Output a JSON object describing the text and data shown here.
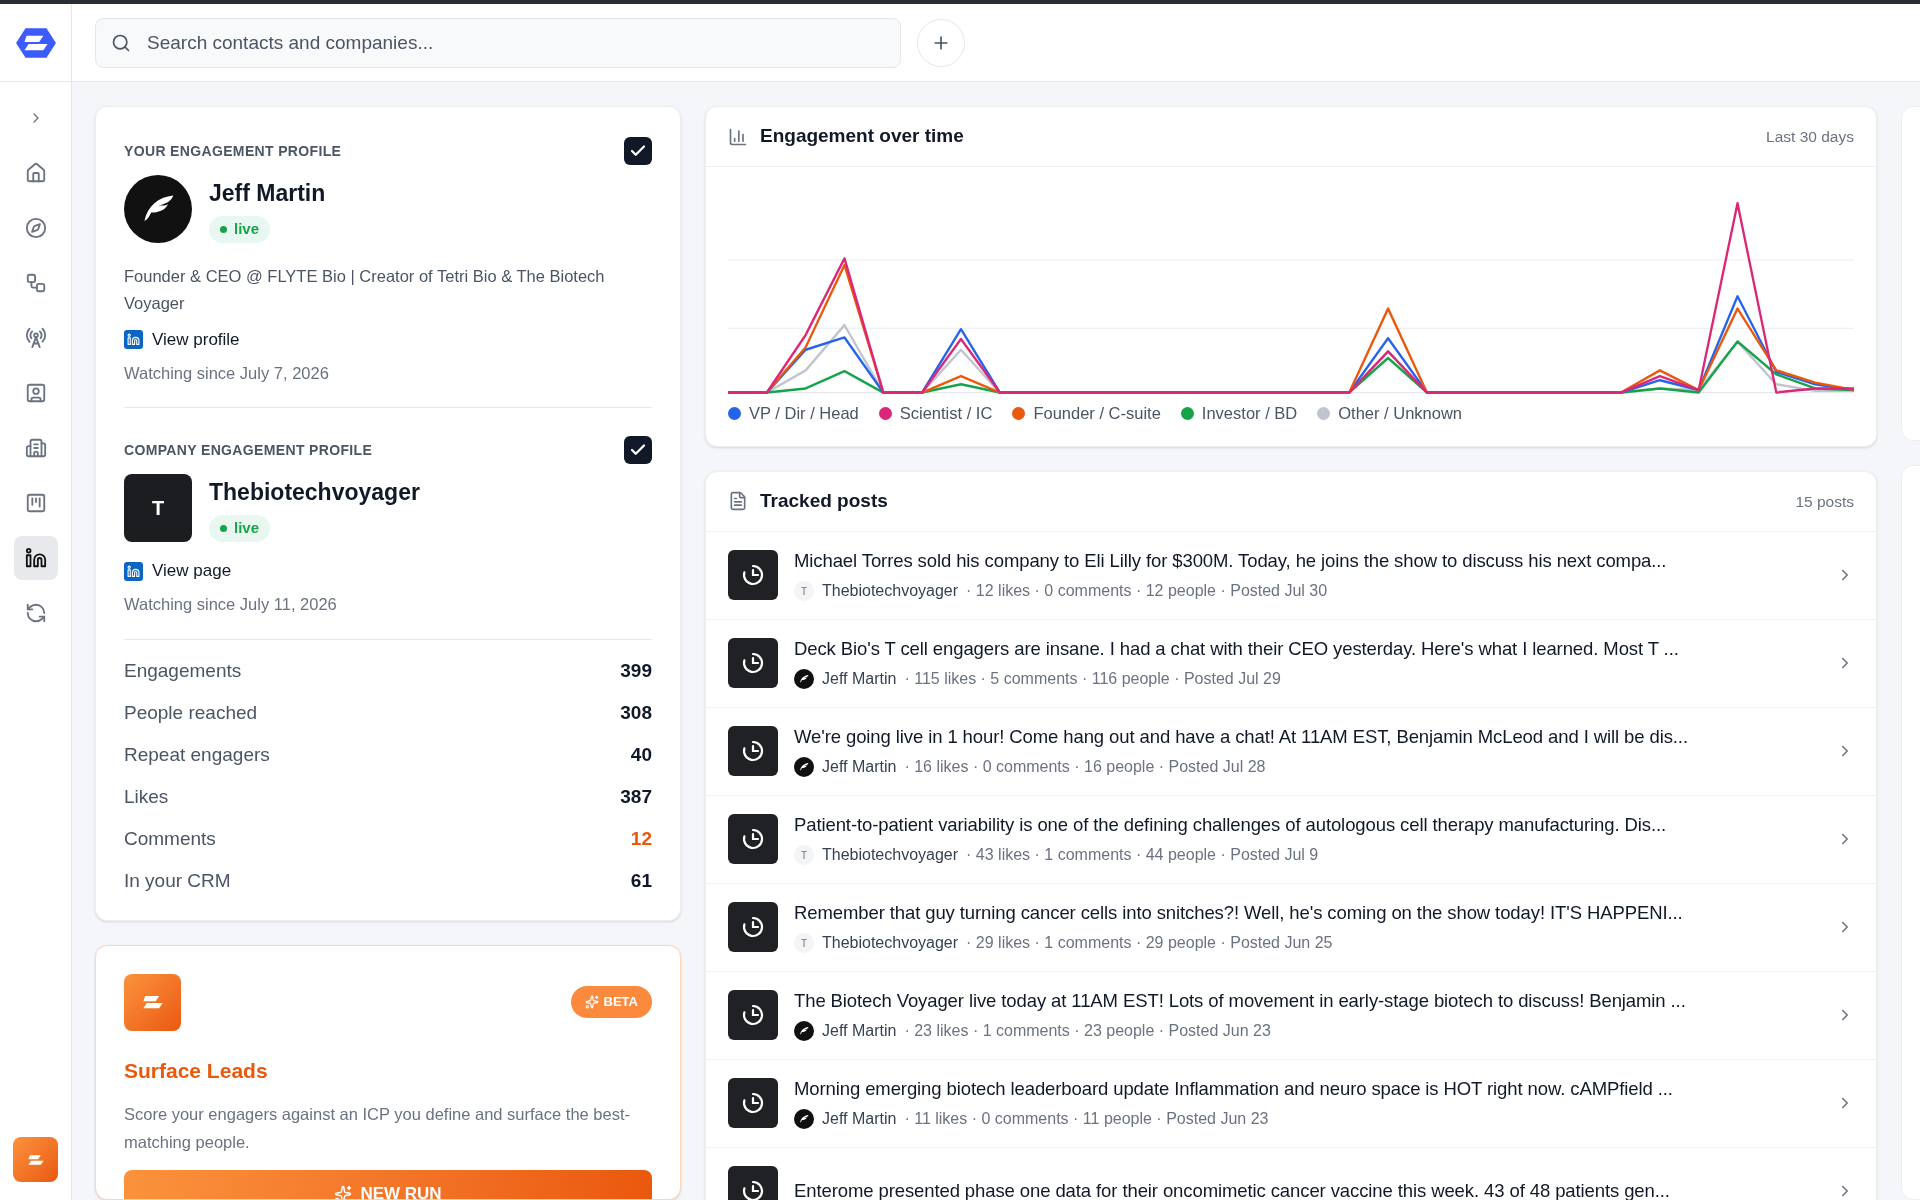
{
  "sidebar": {
    "items": [
      {
        "kind": "expand",
        "selected": false
      },
      {
        "kind": "home",
        "selected": false
      },
      {
        "kind": "explore",
        "selected": false
      },
      {
        "kind": "workflow",
        "selected": false
      },
      {
        "kind": "signals",
        "selected": false
      },
      {
        "kind": "contacts",
        "selected": false
      },
      {
        "kind": "companies",
        "selected": false
      },
      {
        "kind": "board",
        "selected": false
      },
      {
        "kind": "linkedin",
        "selected": true
      },
      {
        "kind": "sync",
        "selected": false
      }
    ]
  },
  "search": {
    "placeholder": "Search contacts and companies..."
  },
  "profiles": [
    {
      "kind": "person",
      "heading": "YOUR ENGAGEMENT PROFILE",
      "checked": true,
      "name": "Jeff Martin",
      "status": "live",
      "bio": "Founder & CEO @ FLYTE Bio | Creator of Tetri Bio & The Biotech Voyager",
      "link": "View profile",
      "since": "Watching since July 7, 2026"
    },
    {
      "kind": "company",
      "heading": "COMPANY ENGAGEMENT PROFILE",
      "checked": true,
      "name": "Thebiotechvoyager",
      "initial": "T",
      "status": "live",
      "link": "View page",
      "since": "Watching since July 11, 2026"
    }
  ],
  "stats": [
    {
      "label": "Engagements",
      "value": "399",
      "highlighted": false
    },
    {
      "label": "People reached",
      "value": "308",
      "highlighted": false
    },
    {
      "label": "Repeat engagers",
      "value": "40",
      "highlighted": false
    },
    {
      "label": "Likes",
      "value": "387",
      "highlighted": false
    },
    {
      "label": "Comments",
      "value": "12",
      "highlighted": true
    },
    {
      "label": "In your CRM",
      "value": "61",
      "highlighted": false
    }
  ],
  "surface_leads": {
    "badge": "BETA",
    "title": "Surface Leads",
    "description": "Score your engagers against an ICP you define and surface the best-matching people.",
    "button": "NEW RUN"
  },
  "engagement_chart": {
    "title": "Engagement over time",
    "range": "Last 30 days",
    "legend": [
      {
        "label": "VP / Dir / Head",
        "color": "#2563eb"
      },
      {
        "label": "Scientist / IC",
        "color": "#db2777"
      },
      {
        "label": "Founder / C-suite",
        "color": "#ea580c"
      },
      {
        "label": "Investor / BD",
        "color": "#16a34a"
      },
      {
        "label": "Other / Unknown",
        "color": "#c0c4cf"
      }
    ]
  },
  "tracked_posts": {
    "title": "Tracked posts",
    "count": "15 posts",
    "posts": [
      {
        "title": "Michael Torres sold his company to Eli Lilly for $300M. Today, he joins the show to discuss his next compa...",
        "kind": "company",
        "author_initial": "T",
        "author": "Thebiotechvoyager",
        "meta": "· 12 likes · 0 comments · 12 people · Posted Jul 30"
      },
      {
        "title": "Deck Bio's T cell engagers are insane. I had a chat with their CEO yesterday. Here's what I learned. Most T ...",
        "kind": "person",
        "author": "Jeff Martin",
        "meta": "· 115 likes · 5 comments · 116 people · Posted Jul 29"
      },
      {
        "title": "We're going live in 1 hour! Come hang out and have a chat! At 11AM EST, Benjamin McLeod and I will be dis...",
        "kind": "person",
        "author": "Jeff Martin",
        "meta": "· 16 likes · 0 comments · 16 people · Posted Jul 28"
      },
      {
        "title": "Patient-to-patient variability is one of the defining challenges of autologous cell therapy manufacturing. Dis...",
        "kind": "company",
        "author_initial": "T",
        "author": "Thebiotechvoyager",
        "meta": "· 43 likes · 1 comments · 44 people · Posted Jul 9"
      },
      {
        "title": "Remember that guy turning cancer cells into snitches?! Well, he's coming on the show today! IT'S HAPPENI...",
        "kind": "company",
        "author_initial": "T",
        "author": "Thebiotechvoyager",
        "meta": "· 29 likes · 1 comments · 29 people · Posted Jun 25"
      },
      {
        "title": "The Biotech Voyager live today at 11AM EST! Lots of movement in early-stage biotech to discuss! Benjamin ...",
        "kind": "person",
        "author": "Jeff Martin",
        "meta": "· 23 likes · 1 comments · 23 people · Posted Jun 23"
      },
      {
        "title": "Morning emerging biotech leaderboard update Inflammation and neuro space is HOT right now. cAMPfield ...",
        "kind": "person",
        "author": "Jeff Martin",
        "meta": "· 11 likes · 0 comments · 11 people · Posted Jun 23"
      },
      {
        "title": "Enterome presented phase one data for their oncomimetic cancer vaccine this week. 43 of 48 patients gen..."
      }
    ]
  }
}
